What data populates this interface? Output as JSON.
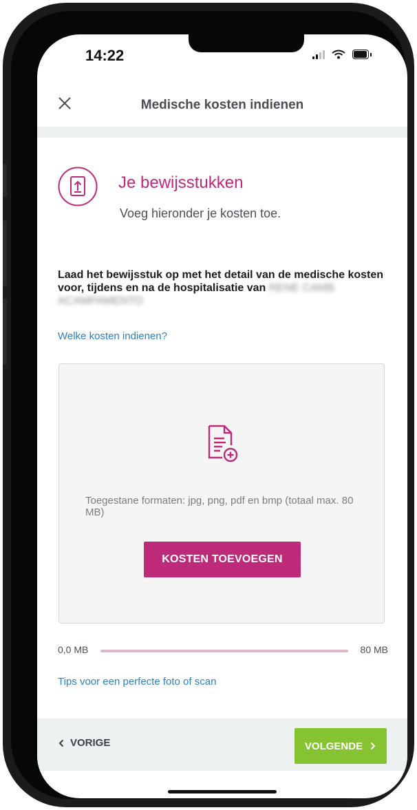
{
  "status_bar": {
    "time": "14:22"
  },
  "header": {
    "title": "Medische kosten indienen"
  },
  "section": {
    "title": "Je bewijsstukken",
    "subtitle": "Voeg hieronder je kosten toe."
  },
  "intro": {
    "text": "Laad het bewijsstuk op met het detail van de medische kosten voor, tijdens en na de hospitalisatie van",
    "redacted_name": "RENE CAMB ACAMPAMENTO"
  },
  "links": {
    "which_costs": "Welke kosten indienen?",
    "photo_tips": "Tips voor een perfecte foto of scan"
  },
  "dropzone": {
    "formats_text": "Toegestane formaten: jpg, png, pdf en bmp (totaal max. 80 MB)",
    "add_button": "KOSTEN TOEVOEGEN"
  },
  "file_size": {
    "current": "0,0 MB",
    "max": "80 MB",
    "used_fraction": 0
  },
  "footer": {
    "prev_label": "VORIGE",
    "next_label": "VOLGENDE"
  },
  "colors": {
    "accent": "#be2a7a",
    "next_button": "#86c332",
    "link": "#2f82c1"
  },
  "icons": [
    "close-icon",
    "upload-document-icon",
    "document-add-icon",
    "chevron-left-icon",
    "chevron-right-icon"
  ]
}
